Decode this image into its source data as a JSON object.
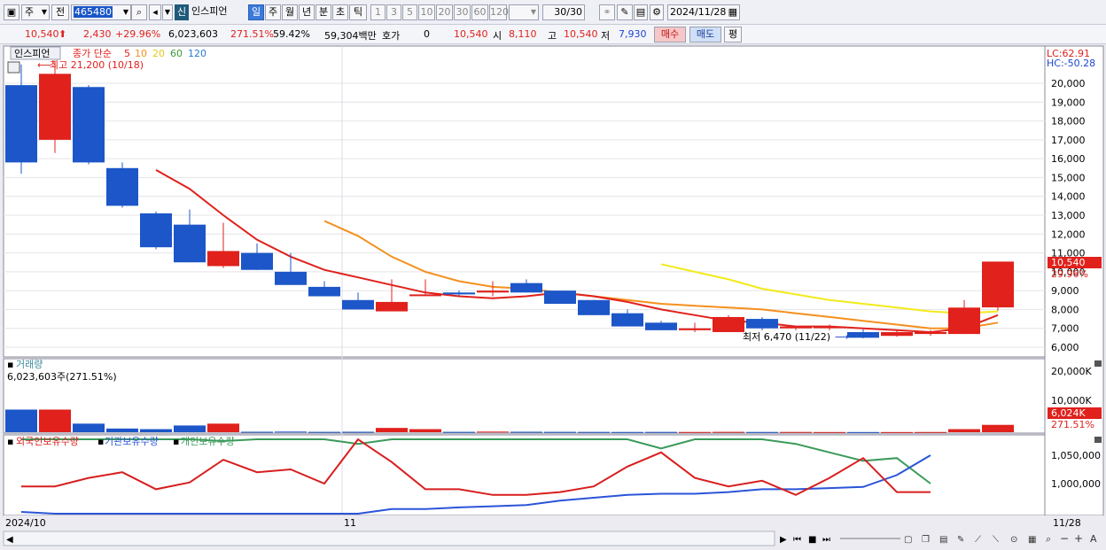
{
  "toolbar": {
    "period_select": "주",
    "market_select": "전",
    "code_value": "465480",
    "stock_badge": "신",
    "stock_name": "인스피언",
    "period_tabs": [
      "일",
      "주",
      "월",
      "년",
      "분",
      "초",
      "틱"
    ],
    "active_period": "일",
    "interval_tabs": [
      "1",
      "3",
      "5",
      "10",
      "20",
      "30",
      "60",
      "120"
    ],
    "count_display": "30/30",
    "date_value": "2024/11/28"
  },
  "quote": {
    "price": "10,540",
    "change": "2,430",
    "change_rate": "+29.96%",
    "volume": "6,023,603",
    "volume_ratio": "271.51%",
    "turnover_rate": "59.42%",
    "amount": "59,304백만",
    "hoga_label": "호가",
    "hoga_value": "0",
    "hoga_price": "10,540",
    "open_label": "시",
    "open_value": "8,110",
    "high_label": "고",
    "high_value": "10,540",
    "low_label": "저",
    "low_value": "7,930",
    "buy_label": "매수",
    "sell_label": "매도",
    "eval_label": "평"
  },
  "colors": {
    "up": "#e0211c",
    "down": "#1c56c8",
    "ma5": "#e0211c",
    "ma10": "#f5901e",
    "ma20": "#f2ea1a",
    "ma60": "#3a9a3a",
    "ma120": "#2a7ad0",
    "foreign": "#d81e1e",
    "institution": "#2a55d8",
    "individual": "#3a9a5a"
  },
  "legend": {
    "name": "인스피언",
    "ma_label": "종가 단순",
    "ma_periods": [
      "5",
      "10",
      "20",
      "60",
      "120"
    ],
    "max_note": "최고 21,200 (10/18)",
    "min_note": "최저 6,470 (11/22)",
    "lc": "LC:62.91",
    "hc": "HC:-50.28",
    "price_tag": "10,540",
    "pct_tag": "29.96%"
  },
  "volume_panel": {
    "title": "거래량",
    "note": "6,023,603주(271.51%)",
    "axis_labels": [
      "20,000K",
      "10,000K"
    ],
    "tag_value": "6,024K",
    "tag_pct": "271.51%"
  },
  "holdings_panel": {
    "foreign_label": "외국인보유수량",
    "institution_label": "기관보유수량",
    "individual_label": "개인보유수량",
    "axis_labels": [
      "1,050,000",
      "1,000,000"
    ]
  },
  "xaxis": {
    "labels": [
      "2024/10",
      "11",
      "11/28"
    ]
  },
  "chart_data": {
    "type": "candlestick",
    "y_ticks": [
      20000,
      19000,
      18000,
      17000,
      16000,
      15000,
      14000,
      13000,
      12000,
      11000,
      10000,
      9000,
      8000,
      7000,
      6000
    ],
    "y_tick_labels": [
      "20,000",
      "19,000",
      "18,000",
      "17,000",
      "16,000",
      "15,000",
      "14,000",
      "13,000",
      "12,000",
      "11,000",
      "10,000",
      "9,000",
      "8,000",
      "7,000",
      "6,000"
    ],
    "candles": [
      {
        "o": 19900,
        "h": 21000,
        "l": 15200,
        "c": 15800
      },
      {
        "o": 17000,
        "h": 21200,
        "l": 16300,
        "c": 20500
      },
      {
        "o": 19800,
        "h": 19900,
        "l": 15700,
        "c": 15800
      },
      {
        "o": 15500,
        "h": 15800,
        "l": 13400,
        "c": 13500
      },
      {
        "o": 13100,
        "h": 13200,
        "l": 11200,
        "c": 11300
      },
      {
        "o": 12500,
        "h": 13300,
        "l": 10500,
        "c": 10500
      },
      {
        "o": 10300,
        "h": 12600,
        "l": 10200,
        "c": 11100
      },
      {
        "o": 11000,
        "h": 11500,
        "l": 10100,
        "c": 10100
      },
      {
        "o": 10000,
        "h": 11000,
        "l": 9300,
        "c": 9300
      },
      {
        "o": 9200,
        "h": 9500,
        "l": 8700,
        "c": 8700
      },
      {
        "o": 8500,
        "h": 8900,
        "l": 8000,
        "c": 8000
      },
      {
        "o": 7900,
        "h": 9600,
        "l": 7900,
        "c": 8400
      },
      {
        "o": 8800,
        "h": 9600,
        "l": 8700,
        "c": 8800
      },
      {
        "o": 8900,
        "h": 9000,
        "l": 8700,
        "c": 8800
      },
      {
        "o": 8900,
        "h": 9500,
        "l": 8700,
        "c": 9000
      },
      {
        "o": 9400,
        "h": 9600,
        "l": 8900,
        "c": 8900
      },
      {
        "o": 9000,
        "h": 9000,
        "l": 8300,
        "c": 8300
      },
      {
        "o": 8500,
        "h": 8500,
        "l": 7700,
        "c": 7700
      },
      {
        "o": 7800,
        "h": 8000,
        "l": 7100,
        "c": 7100
      },
      {
        "o": 7300,
        "h": 7400,
        "l": 6900,
        "c": 6900
      },
      {
        "o": 6900,
        "h": 7300,
        "l": 6800,
        "c": 7000
      },
      {
        "o": 6800,
        "h": 7700,
        "l": 6800,
        "c": 7600
      },
      {
        "o": 7500,
        "h": 7600,
        "l": 6900,
        "c": 7000
      },
      {
        "o": 7000,
        "h": 7100,
        "l": 6900,
        "c": 7100
      },
      {
        "o": 7100,
        "h": 7200,
        "l": 6900,
        "c": 7100
      },
      {
        "o": 6800,
        "h": 6950,
        "l": 6470,
        "c": 6500
      },
      {
        "o": 6600,
        "h": 6900,
        "l": 6550,
        "c": 6800
      },
      {
        "o": 6700,
        "h": 6900,
        "l": 6600,
        "c": 6800
      },
      {
        "o": 6700,
        "h": 8500,
        "l": 6700,
        "c": 8100
      },
      {
        "o": 8110,
        "h": 10540,
        "l": 7930,
        "c": 10540
      }
    ],
    "ma5": [
      null,
      null,
      null,
      null,
      15400,
      14400,
      13000,
      11700,
      10800,
      10100,
      9700,
      9300,
      8900,
      8700,
      8600,
      8700,
      8900,
      8700,
      8400,
      8000,
      7700,
      7400,
      7300,
      7100,
      7100,
      7000,
      6900,
      6800,
      7000,
      7700
    ],
    "ma10": [
      null,
      null,
      null,
      null,
      null,
      null,
      null,
      null,
      null,
      12700,
      11900,
      10800,
      10000,
      9500,
      9200,
      9100,
      8900,
      8700,
      8500,
      8300,
      8200,
      8100,
      8000,
      7800,
      7600,
      7400,
      7200,
      7000,
      7000,
      7300
    ],
    "ma20": [
      null,
      null,
      null,
      null,
      null,
      null,
      null,
      null,
      null,
      null,
      null,
      null,
      null,
      null,
      null,
      null,
      null,
      null,
      null,
      10400,
      10000,
      9600,
      9100,
      8800,
      8500,
      8300,
      8100,
      7900,
      7800,
      7900
    ],
    "volume_k": [
      7400,
      7400,
      2800,
      1200,
      1000,
      2200,
      2800,
      150,
      200,
      120,
      150,
      1400,
      1000,
      120,
      200,
      150,
      120,
      100,
      80,
      100,
      80,
      120,
      80,
      90,
      60,
      60,
      50,
      70,
      1000,
      2400
    ],
    "volume_ylim": [
      0,
      22000
    ],
    "foreign_hold": [
      1015000,
      1015000,
      1030000,
      1040000,
      1010000,
      1022000,
      1062000,
      1040000,
      1045000,
      1020000,
      1098000,
      1058000,
      1010000,
      1010000,
      1000000,
      1000000,
      1005000,
      1015000,
      1050000,
      1075000,
      1030000,
      1015000,
      1025000,
      1000000,
      1030000,
      1065000,
      1005000,
      1005000
    ],
    "institution_hold": [
      1020000,
      1005000,
      1005000,
      1010000,
      1010000,
      1010000,
      1010000,
      1010000,
      1012000,
      1012000,
      1016000,
      1025000,
      1025000,
      1028000,
      1030000,
      1032000,
      1040000,
      1045000,
      1050000,
      1052000,
      1052000,
      1055000,
      1060000,
      1060000,
      1062000,
      1064000,
      1085000,
      1120000
    ],
    "individual_hold": [
      1110000,
      1120000,
      1112000,
      1104000,
      1108000,
      1104000,
      1075000,
      1100000,
      1110000,
      1095000,
      1070000,
      1110000,
      1108000,
      1108000,
      1106000,
      1110000,
      1108000,
      1095000,
      1082000,
      1062000,
      1080000,
      1085000,
      1080000,
      1070000,
      1055000,
      1040000,
      1045000,
      1000000
    ]
  }
}
